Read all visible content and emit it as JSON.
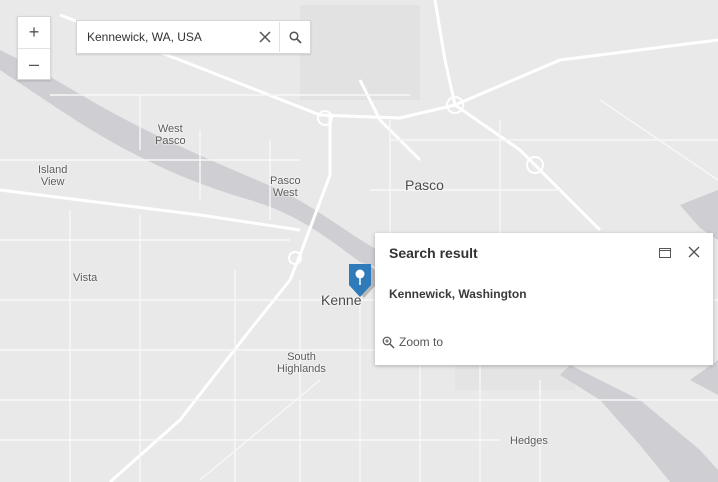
{
  "search": {
    "value": "Kennewick, WA, USA",
    "clear_icon": "close-icon",
    "search_icon": "search-icon"
  },
  "zoom": {
    "in_label": "+",
    "out_label": "–"
  },
  "places": {
    "west_pasco_1": "West",
    "west_pasco_2": "Pasco",
    "island_view_1": "Island",
    "island_view_2": "View",
    "pasco_west_1": "Pasco",
    "pasco_west_2": "West",
    "pasco": "Pasco",
    "vista": "Vista",
    "kennewick": "Kenne",
    "south_highlands_1": "South",
    "south_highlands_2": "Highlands",
    "hedges": "Hedges"
  },
  "popup": {
    "title": "Search result",
    "result": "Kennewick, Washington",
    "zoom_to": "Zoom to",
    "dock_icon": "dock-icon",
    "close_icon": "close-icon"
  },
  "colors": {
    "land": "#e9e9e9",
    "water": "#cfcfd3",
    "road": "#ffffff",
    "marker": "#2f7ab9"
  }
}
